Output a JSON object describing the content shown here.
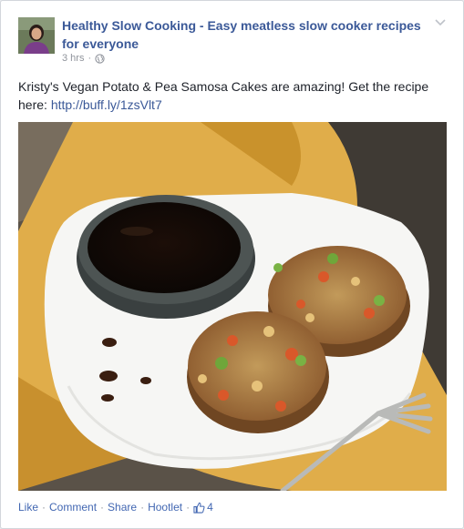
{
  "post": {
    "page_name": "Healthy Slow Cooking - Easy meatless slow cooker recipes for everyone",
    "time": "3 hrs",
    "separator": "·",
    "text_main": "Kristy's Vegan Potato & Pea Samosa Cakes are amazing! Get the recipe here: ",
    "link": "http://buff.ly/1zsVlt7",
    "image_alt": "Vegan potato and pea samosa cakes on a white plate with a dark dipping sauce"
  },
  "actions": {
    "like": "Like",
    "comment": "Comment",
    "share": "Share",
    "hootlet": "Hootlet",
    "dot": "·",
    "like_count": "4"
  },
  "colors": {
    "link": "#3b5998",
    "action": "#4267b2",
    "meta": "#90949c"
  },
  "icons": {
    "globe": "globe-icon",
    "chevron": "chevron-down-icon",
    "thumbs_up": "thumbs-up-icon"
  }
}
